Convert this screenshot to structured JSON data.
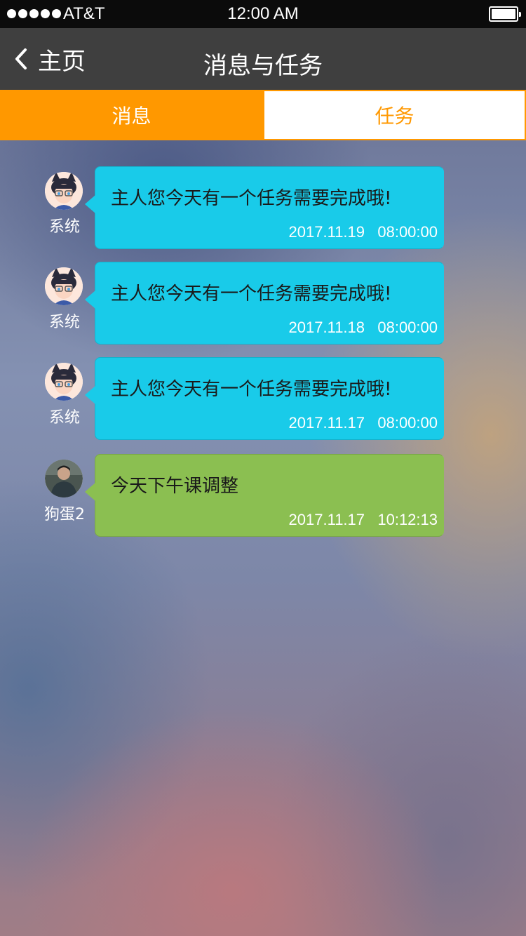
{
  "status_bar": {
    "carrier": "AT&T",
    "time": "12:00 AM",
    "signal_bars": 5,
    "battery_level": 1.0
  },
  "nav": {
    "back_label": "主页",
    "title": "消息与任务"
  },
  "tabs": [
    {
      "label": "消息",
      "active": true
    },
    {
      "label": "任务",
      "active": false
    }
  ],
  "messages": [
    {
      "sender": "系统",
      "avatar": "cartoon-girl-avatar",
      "text": "主人您今天有一个任务需要完成哦!",
      "date": "2017.11.19",
      "time": "08:00:00",
      "bubble_color": "#19cbe9"
    },
    {
      "sender": "系统",
      "avatar": "cartoon-girl-avatar",
      "text": "主人您今天有一个任务需要完成哦!",
      "date": "2017.11.18",
      "time": "08:00:00",
      "bubble_color": "#19cbe9"
    },
    {
      "sender": "系统",
      "avatar": "cartoon-girl-avatar",
      "text": "主人您今天有一个任务需要完成哦!",
      "date": "2017.11.17",
      "time": "08:00:00",
      "bubble_color": "#19cbe9"
    },
    {
      "sender": "狗蛋2",
      "avatar": "user-photo-avatar",
      "text": "今天下午课调整",
      "date": "2017.11.17",
      "time": "10:12:13",
      "bubble_color": "#8bbf51"
    }
  ],
  "colors": {
    "accent": "#ff9800",
    "nav_bg": "#3f3f3f",
    "system_bubble": "#19cbe9",
    "user_bubble": "#8bbf51"
  }
}
